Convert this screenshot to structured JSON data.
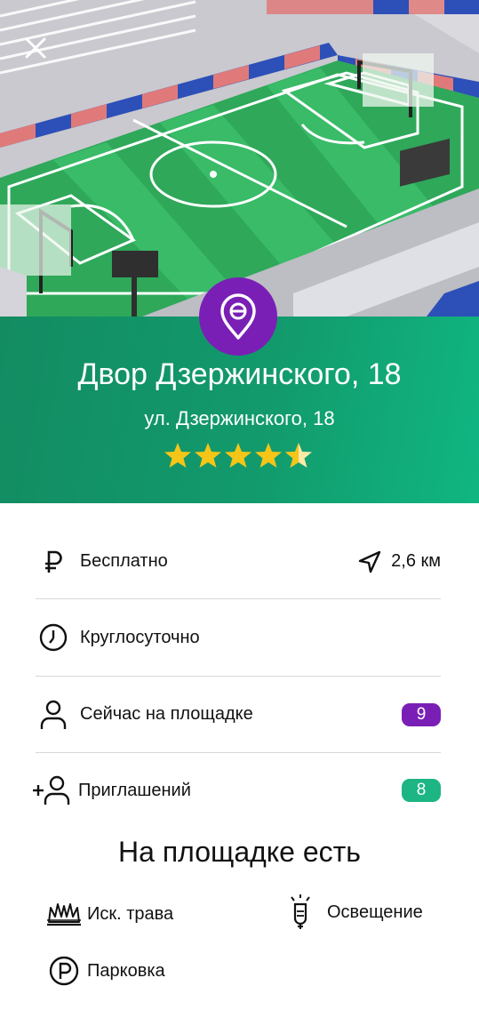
{
  "header": {
    "title": "Двор Дзержинского, 18",
    "address": "ул. Дзержинского, 18",
    "rating": 4.5,
    "rating_max": 5
  },
  "info": {
    "price_label": "Бесплатно",
    "distance": "2,6 км",
    "hours_label": "Круглосуточно",
    "present_label": "Сейчас на площадке",
    "present_count": "9",
    "invites_label": "Приглашений",
    "invites_count": "8"
  },
  "amenities": {
    "title": "На площадке есть",
    "items": [
      {
        "label": "Иск. трава",
        "icon": "grass-icon"
      },
      {
        "label": "Освещение",
        "icon": "lightbulb-icon"
      },
      {
        "label": "Парковка",
        "icon": "parking-icon"
      }
    ]
  },
  "colors": {
    "header_green": "#129a6c",
    "accent_purple": "#7a1fb5",
    "badge_green": "#1db584",
    "star": "#f5c518"
  }
}
